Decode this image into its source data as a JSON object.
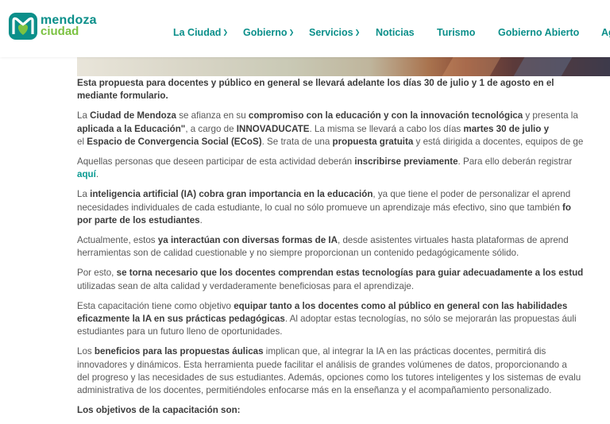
{
  "header": {
    "logo_line1": "mendoza",
    "logo_line2": "ciudad",
    "nav": [
      {
        "label": "La Ciudad",
        "chevron": true
      },
      {
        "label": "Gobierno",
        "chevron": true
      },
      {
        "label": "Servicios",
        "chevron": true
      },
      {
        "label": "Noticias",
        "chevron": false
      },
      {
        "label": "Turismo",
        "chevron": false
      },
      {
        "label": "Gobierno Abierto",
        "chevron": false
      },
      {
        "label": "Ag",
        "chevron": false
      }
    ]
  },
  "article": {
    "p1": {
      "l1": [
        {
          "t": "Esta propuesta para docentes y público en general se llevará adelante los días 30 de julio y 1 de agosto en el",
          "b": true
        }
      ],
      "l2": [
        {
          "t": "mediante formulario.",
          "b": true
        }
      ]
    },
    "p2": {
      "l1": [
        {
          "t": "La "
        },
        {
          "t": "Ciudad de Mendoza",
          "b": true
        },
        {
          "t": " se afianza en su "
        },
        {
          "t": "compromiso con la educación y con la innovación tecnológica",
          "b": true
        },
        {
          "t": " y presenta la"
        }
      ],
      "l2": [
        {
          "t": "aplicada a la Educación\"",
          "b": true
        },
        {
          "t": ", a cargo de "
        },
        {
          "t": "INNOVADUCATE",
          "b": true
        },
        {
          "t": ". La misma se llevará a cabo los días "
        },
        {
          "t": "martes 30 de julio y",
          "b": true
        }
      ],
      "l3": [
        {
          "t": "el "
        },
        {
          "t": "Espacio de Convergencia Social (ECoS)",
          "b": true
        },
        {
          "t": ". Se trata de una "
        },
        {
          "t": "propuesta gratuita",
          "b": true
        },
        {
          "t": " y está dirigida a docentes, equipos de ge"
        }
      ]
    },
    "p3": {
      "l1": [
        {
          "t": "Aquellas personas que deseen participar de esta actividad deberán "
        },
        {
          "t": "inscribirse previamente",
          "b": true
        },
        {
          "t": ". Para ello deberán registrar"
        }
      ],
      "l2": [
        {
          "t": "aquí",
          "link": true
        },
        {
          "t": "."
        }
      ]
    },
    "p4": {
      "l1": [
        {
          "t": "La "
        },
        {
          "t": "inteligencia artificial (IA) cobra gran importancia en la educación",
          "b": true
        },
        {
          "t": ", ya que tiene el poder de personalizar el aprend"
        }
      ],
      "l2": [
        {
          "t": "necesidades individuales de cada estudiante, lo cual no sólo promueve un aprendizaje más efectivo, sino que también "
        },
        {
          "t": "fo",
          "b": true
        }
      ],
      "l3": [
        {
          "t": "por parte de los estudiantes",
          "b": true
        },
        {
          "t": "."
        }
      ]
    },
    "p5": {
      "l1": [
        {
          "t": "Actualmente, estos "
        },
        {
          "t": "ya interactúan con diversas formas de IA",
          "b": true
        },
        {
          "t": ", desde asistentes virtuales hasta plataformas de aprend"
        }
      ],
      "l2": [
        {
          "t": "herramientas son de calidad cuestionable y no siempre proporcionan un contenido pedagógicamente sólido."
        }
      ]
    },
    "p6": {
      "l1": [
        {
          "t": "Por esto, "
        },
        {
          "t": "se torna necesario que los docentes comprendan estas tecnologías para guiar adecuadamente a los estud",
          "b": true
        }
      ],
      "l2": [
        {
          "t": "utilizadas sean de alta calidad y verdaderamente beneficiosas para el aprendizaje."
        }
      ]
    },
    "p7": {
      "l1": [
        {
          "t": "Esta capacitación tiene como objetivo "
        },
        {
          "t": "equipar tanto a los docentes como al público en general con las habilidades",
          "b": true
        }
      ],
      "l2": [
        {
          "t": "eficazmente la IA en sus prácticas pedagógicas",
          "b": true
        },
        {
          "t": ". Al adoptar estas tecnologías, no sólo se mejorarán las propuestas áuli"
        }
      ],
      "l3": [
        {
          "t": "estudiantes para un futuro lleno de oportunidades."
        }
      ]
    },
    "p8": {
      "l1": [
        {
          "t": "Los "
        },
        {
          "t": "beneficios para las propuestas áulicas",
          "b": true
        },
        {
          "t": " implican que, al integrar la IA en las prácticas docentes, permitirá dis"
        }
      ],
      "l2": [
        {
          "t": "innovadores y dinámicos. Esta herramienta puede facilitar el análisis de grandes volúmenes de datos, proporcionando a"
        }
      ],
      "l3": [
        {
          "t": "del progreso y las necesidades de sus estudiantes. Además, opciones como los tutores inteligentes y los sistemas de evalu"
        }
      ],
      "l4": [
        {
          "t": "administrativa de los docentes, permitiéndoles enfocarse más en la enseñanza y el acompañamiento personalizado."
        }
      ]
    },
    "objectives_heading": "Los objetivos de la capacitación son:"
  },
  "colors": {
    "brand_teal": "#0b8f8a",
    "brand_green": "#7cc242",
    "link": "#0b9a92"
  }
}
